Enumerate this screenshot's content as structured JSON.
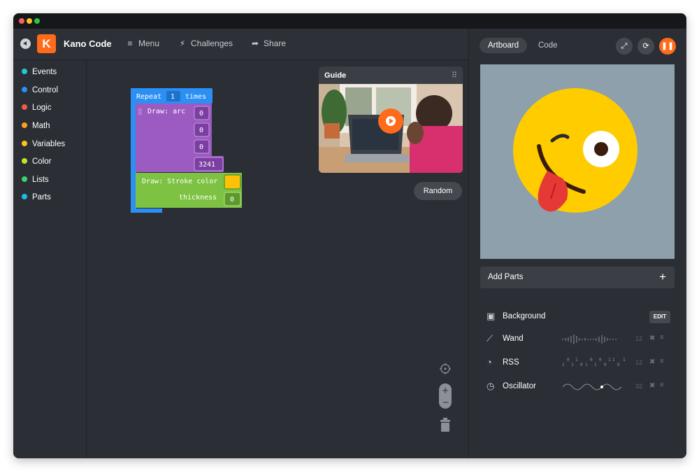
{
  "app": {
    "title": "Kano Code",
    "logo_letter": "K"
  },
  "window_dots": [
    "#ff5f56",
    "#ffbd2e",
    "#27c93f"
  ],
  "nav": {
    "menu": "Menu",
    "challenges": "Challenges",
    "share": "Share"
  },
  "categories": [
    {
      "label": "Events",
      "color": "#1ec8d4"
    },
    {
      "label": "Control",
      "color": "#2b8ff4"
    },
    {
      "label": "Logic",
      "color": "#f25a4b"
    },
    {
      "label": "Math",
      "color": "#ff9f1c"
    },
    {
      "label": "Variables",
      "color": "#ffc21a"
    },
    {
      "label": "Color",
      "color": "#c6e12b"
    },
    {
      "label": "Lists",
      "color": "#3fd36b"
    },
    {
      "label": "Parts",
      "color": "#1eb9e8"
    }
  ],
  "blocks": {
    "repeat": {
      "label": "Repeat",
      "count": "1",
      "suffix": "times"
    },
    "arc": {
      "label": "Draw: arc",
      "args": [
        "0",
        "0",
        "0",
        "3241"
      ]
    },
    "stroke": {
      "label": "Draw: Stroke color",
      "thickness_label": "thickness",
      "thickness_value": "0",
      "color": "#ffc107"
    }
  },
  "guide": {
    "title": "Guide",
    "random_label": "Random"
  },
  "right": {
    "tabs": {
      "artboard": "Artboard",
      "code": "Code"
    },
    "add_parts": "Add Parts",
    "parts": [
      {
        "label": "Background",
        "action": "EDIT",
        "icon": "image-icon"
      },
      {
        "label": "Wand",
        "value": "12",
        "icon": "wand-icon"
      },
      {
        "label": "RSS",
        "value": "12",
        "icon": "rss-icon"
      },
      {
        "label": "Oscillator",
        "value": "32",
        "icon": "oscillator-icon"
      }
    ]
  },
  "colors": {
    "accent": "#ff6b1a",
    "control_block": "#2b8ff4",
    "draw_block": "#9b5bc0",
    "stroke_block": "#7dc242",
    "artboard_bg": "#8da0ab",
    "emoji_face": "#ffcc00"
  }
}
